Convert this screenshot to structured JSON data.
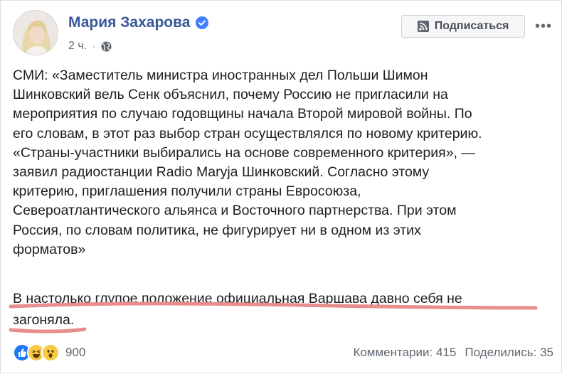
{
  "post": {
    "author": "Мария Захарова",
    "time": "2 ч.",
    "dot": "·",
    "subscribe_label": "Подписаться",
    "more_label": "•••",
    "body_lines": [
      "СМИ: «Заместитель министра иностранных дел Польши Шимон",
      "Шинковский вель Сенк объяснил, почему Россию не пригласили на",
      "мероприятия по случаю годовщины начала Второй мировой войны. По",
      "его словам, в этот раз выбор стран осуществлялся по новому критерию.",
      "«Страны-участники выбирались на основе современного критерия», —",
      "заявил радиостанции Radio Maryja Шинковский. Согласно этому",
      "критерию, приглашения получили страны Евросоюза,",
      "Североатлантического альянса и Восточного партнерства. При этом",
      "Россия, по словам политика, не фигурирует ни в одном из этих",
      "форматов»"
    ],
    "highlight_lines": [
      "В настолько глупое положение официальная Варшава давно себя не",
      "загоняла."
    ],
    "reactions_count": "900",
    "comments": "Комментарии: 415",
    "shares": "Поделились: 35"
  },
  "colors": {
    "author": "#385898",
    "underline": "#e88c8c",
    "like": "#2078f4",
    "emoji": "#f7c945"
  },
  "icons": [
    "verified-badge-icon",
    "globe-icon",
    "rss-icon",
    "like-icon",
    "haha-icon",
    "wow-icon"
  ]
}
